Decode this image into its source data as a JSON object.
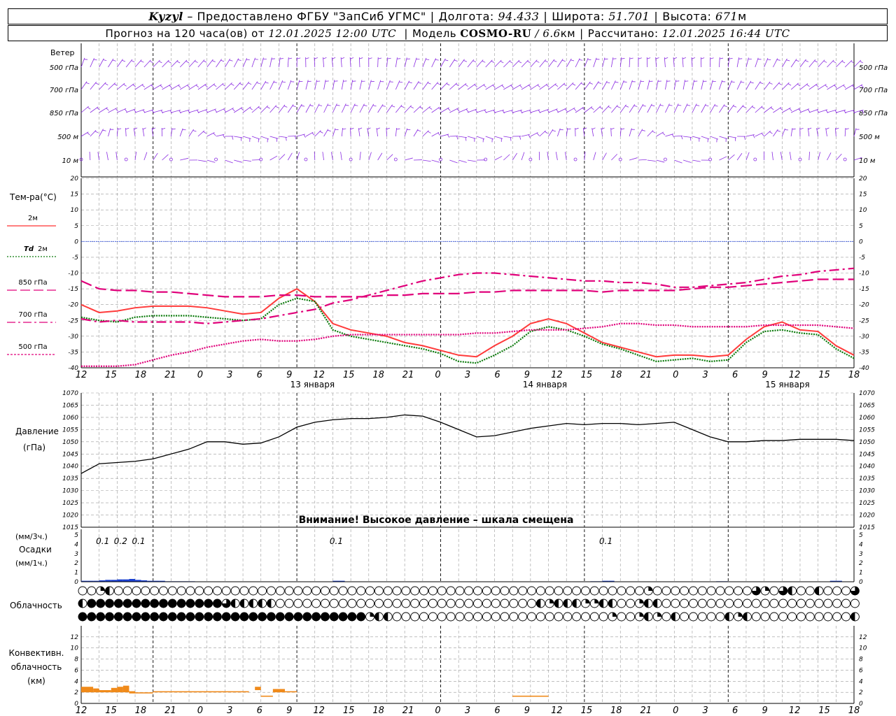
{
  "header": {
    "station": "Kyzyl",
    "provided": "– Предоставлено ФГБУ \"ЗапСиб УГМС\"",
    "lon_label": "Долгота:",
    "lon": "94.433",
    "lat_label": "Широта:",
    "lat": "51.701",
    "alt_label": "Высота:",
    "alt": "671",
    "alt_unit": "м",
    "forecast_label": "Прогноз на 120 часа(ов) от",
    "forecast_from": "12.01.2025 12:00 UTC",
    "model_label": "Модель",
    "model": "COSMO-RU",
    "model_res": "/ 6.6",
    "model_res_unit": "км",
    "calc_label": "Рассчитано:",
    "calc": "12.01.2025 16:44 UTC"
  },
  "wind_panel": {
    "title": "Ветер",
    "levels": [
      "500 гПа",
      "700 гПа",
      "850 гПа",
      "500 м",
      "10 м"
    ],
    "color": "#8a2be2"
  },
  "temp_panel": {
    "title": "Тем-ра(°С)",
    "ylim": [
      -40,
      20
    ],
    "yticks": [
      "20",
      "15",
      "10",
      "5",
      "0",
      "-5",
      "-10",
      "-15",
      "-20",
      "-25",
      "-30",
      "-35",
      "-40"
    ],
    "legend": [
      {
        "label": "2м",
        "color": "#ff3030",
        "dash": "solid"
      },
      {
        "label": "Td",
        "label2": "2м",
        "color": "#0a7a0a",
        "dash": "dot"
      },
      {
        "label": "850 гПа",
        "color": "#e0007a",
        "dash": "longdash"
      },
      {
        "label": "700 гПа",
        "color": "#e0007a",
        "dash": "dashdot"
      },
      {
        "label": "500 гПа",
        "color": "#e0007a",
        "dash": "dense"
      }
    ]
  },
  "x_axis": {
    "hour_labels": [
      "12",
      "15",
      "18",
      "21",
      "0",
      "3",
      "6",
      "9",
      "12",
      "15",
      "18",
      "21",
      "0",
      "3",
      "6",
      "9",
      "12",
      "15",
      "18",
      "21",
      "0",
      "3",
      "6",
      "9",
      "12",
      "15",
      "18"
    ],
    "day_labels": [
      "13 января",
      "14 января",
      "15 января"
    ]
  },
  "pressure_panel": {
    "title": "Давление",
    "unit": "(гПа)",
    "ylim": [
      1015,
      1070
    ],
    "yticks": [
      "1070",
      "1065",
      "1060",
      "1055",
      "1050",
      "1045",
      "1040",
      "1035",
      "1030",
      "1025",
      "1020",
      "1015"
    ],
    "notice": "Внимание! Высокое давление – шкала смещена"
  },
  "precip_panel": {
    "unit3": "(мм/3ч.)",
    "title": "Осадки",
    "unit1": "(мм/1ч.)",
    "ylim": [
      0,
      5
    ],
    "yticks": [
      "5",
      "4",
      "3",
      "2",
      "1",
      "0"
    ],
    "sum_labels": [
      {
        "text": "0.1",
        "hour": 3
      },
      {
        "text": "0.2",
        "hour": 6
      },
      {
        "text": "0.1",
        "hour": 9
      },
      {
        "text": "0.1",
        "hour": 42
      },
      {
        "text": "0.1",
        "hour": 87
      }
    ],
    "color": "#1a3fd0"
  },
  "cloud_panel": {
    "title": "Облачность",
    "rows": 3
  },
  "conv_panel": {
    "title": [
      "Конвективн.",
      "облачность",
      "(км)"
    ],
    "ylim": [
      0,
      14
    ],
    "yticks": [
      "12",
      "10",
      "8",
      "6",
      "4",
      "2",
      "0"
    ],
    "color": "#f08a1a"
  },
  "chart_data": [
    {
      "type": "line",
      "title": "Тем-ра(°С)",
      "x_unit": "hours from 12.01.2025 12:00 UTC",
      "x": [
        0,
        3,
        6,
        9,
        12,
        15,
        18,
        21,
        24,
        27,
        30,
        33,
        36,
        39,
        42,
        45,
        48,
        51,
        54,
        57,
        60,
        63,
        66,
        69,
        72,
        75,
        78,
        81,
        84,
        87,
        90,
        93,
        96,
        99,
        102,
        105,
        108,
        111,
        114,
        117,
        120,
        123,
        126,
        129
      ],
      "ylim": [
        -40,
        20
      ],
      "series": [
        {
          "name": "2м",
          "values": [
            -20,
            -22.5,
            -22,
            -21,
            -20.5,
            -20.5,
            -20.5,
            -21,
            -22,
            -23,
            -22.5,
            -18,
            -15,
            -19,
            -26,
            -28,
            -29,
            -30,
            -32,
            -33,
            -34.5,
            -36,
            -36.5,
            -33,
            -30,
            -26,
            -24.5,
            -26,
            -29,
            -32,
            -33.5,
            -35,
            -36.5,
            -36,
            -36,
            -36.5,
            -36,
            -31,
            -27,
            -25.5,
            -28,
            -28.5,
            -33,
            -36
          ]
        },
        {
          "name": "Td 2м",
          "values": [
            -24,
            -25,
            -25.5,
            -24,
            -23.5,
            -23.5,
            -23.5,
            -24,
            -24.5,
            -25,
            -24.5,
            -20,
            -18,
            -19,
            -28,
            -30,
            -31,
            -32,
            -33,
            -34,
            -35.5,
            -38,
            -38.5,
            -36,
            -33,
            -28.5,
            -27,
            -28,
            -30,
            -32.5,
            -34,
            -36,
            -38,
            -37.5,
            -37,
            -38,
            -37.5,
            -32,
            -28.5,
            -28,
            -29,
            -29.5,
            -34,
            -37
          ]
        },
        {
          "name": "850 гПа",
          "values": [
            -12.5,
            -15,
            -15.5,
            -15.5,
            -16,
            -16,
            -16.5,
            -17,
            -17.5,
            -17.5,
            -17.5,
            -17,
            -17,
            -17.5,
            -17.5,
            -17.5,
            -17.5,
            -17,
            -17,
            -16.5,
            -16.5,
            -16.5,
            -16,
            -16,
            -15.5,
            -15.5,
            -15.5,
            -15.5,
            -15.5,
            -16,
            -15.5,
            -15.5,
            -15.5,
            -15.5,
            -15,
            -14.5,
            -14.5,
            -14,
            -13.5,
            -13,
            -12.5,
            -12,
            -12,
            -12
          ]
        },
        {
          "name": "700 гПа",
          "values": [
            -24.5,
            -25.5,
            -25,
            -25.5,
            -25.5,
            -25.5,
            -25.5,
            -26,
            -25.5,
            -25,
            -24.5,
            -23.5,
            -22.5,
            -21.5,
            -19.5,
            -18.5,
            -17,
            -15.5,
            -14,
            -12.5,
            -11.5,
            -10.5,
            -10,
            -10,
            -10.5,
            -11,
            -11.5,
            -12,
            -12.5,
            -12.5,
            -13,
            -13,
            -13.5,
            -14.5,
            -14.5,
            -14,
            -13.5,
            -13,
            -12,
            -11,
            -10.5,
            -9.5,
            -9,
            -8.5
          ]
        },
        {
          "name": "500 гПа",
          "values": [
            -39.5,
            -39.5,
            -39.5,
            -39,
            -37.5,
            -36,
            -35,
            -33.5,
            -32.5,
            -31.5,
            -31,
            -31.5,
            -31.5,
            -31,
            -30,
            -29.5,
            -29.5,
            -29.5,
            -29.5,
            -29.5,
            -29.5,
            -29.5,
            -29,
            -29,
            -28.5,
            -28,
            -28,
            -28,
            -27.5,
            -27,
            -26,
            -26,
            -26.5,
            -26.5,
            -27,
            -27,
            -27,
            -27,
            -26.5,
            -26.5,
            -26.5,
            -26.5,
            -27,
            -27.5
          ]
        }
      ]
    },
    {
      "type": "line",
      "title": "Давление (гПа)",
      "x_unit": "hours from 12.01.2025 12:00 UTC",
      "x": [
        0,
        3,
        6,
        9,
        12,
        15,
        18,
        21,
        24,
        27,
        30,
        33,
        36,
        39,
        42,
        45,
        48,
        51,
        54,
        57,
        60,
        63,
        66,
        69,
        72,
        75,
        78,
        81,
        84,
        87,
        90,
        93,
        96,
        99,
        102,
        105,
        108,
        111,
        114,
        117,
        120,
        123,
        126,
        129
      ],
      "ylim": [
        1015,
        1070
      ],
      "series": [
        {
          "name": "Давление",
          "values": [
            1037,
            1041,
            1041.5,
            1042,
            1043,
            1045,
            1047,
            1050,
            1050,
            1049,
            1049.5,
            1052,
            1056,
            1058,
            1059,
            1059.5,
            1059.5,
            1060,
            1061,
            1060.5,
            1058,
            1055,
            1052,
            1052.5,
            1054,
            1055.5,
            1056.5,
            1057.5,
            1057,
            1057.5,
            1057.5,
            1057,
            1057.5,
            1058,
            1055,
            1052,
            1050,
            1050,
            1050.5,
            1050.5,
            1051,
            1051,
            1051,
            1050.5
          ]
        }
      ]
    },
    {
      "type": "bar",
      "title": "Осадки",
      "x_unit": "hours from 12.01.2025 12:00 UTC",
      "x": [
        0,
        1,
        2,
        3,
        4,
        5,
        6,
        7,
        8,
        9,
        10,
        11,
        12,
        13,
        14,
        15,
        16,
        17,
        18,
        42,
        43,
        85,
        86,
        87,
        88,
        106,
        107,
        125,
        126
      ],
      "values": [
        0.1,
        0.1,
        0.1,
        0.15,
        0.2,
        0.2,
        0.25,
        0.25,
        0.3,
        0.2,
        0.15,
        0.1,
        0.1,
        0.1,
        0.05,
        0.05,
        0.05,
        0.05,
        0.05,
        0.1,
        0.1,
        0.05,
        0.05,
        0.1,
        0.1,
        0.05,
        0.05,
        0.1,
        0.1
      ],
      "ylim": [
        0,
        5
      ]
    },
    {
      "type": "bar",
      "title": "Конвективн. облачность (км)",
      "x_unit": "hours from 12.01.2025 12:00 UTC",
      "segments": [
        {
          "x0": 0,
          "x1": 2,
          "bottom": 2,
          "top": 3
        },
        {
          "x0": 2,
          "x1": 3,
          "bottom": 2,
          "top": 2.7
        },
        {
          "x0": 3,
          "x1": 5,
          "bottom": 2,
          "top": 2.4
        },
        {
          "x0": 5,
          "x1": 6,
          "bottom": 2,
          "top": 2.8
        },
        {
          "x0": 6,
          "x1": 7,
          "bottom": 2,
          "top": 3
        },
        {
          "x0": 7,
          "x1": 8,
          "bottom": 2,
          "top": 3.2
        },
        {
          "x0": 8,
          "x1": 9,
          "bottom": 1.8,
          "top": 2.2
        },
        {
          "x0": 9,
          "x1": 12,
          "bottom": 1.8,
          "top": 2.0
        },
        {
          "x0": 12,
          "x1": 28,
          "bottom": 2,
          "top": 2.2
        },
        {
          "x0": 29,
          "x1": 30,
          "bottom": 2.4,
          "top": 3
        },
        {
          "x0": 30,
          "x1": 32,
          "bottom": 1.2,
          "top": 1.4
        },
        {
          "x0": 32,
          "x1": 34,
          "bottom": 2,
          "top": 2.6
        },
        {
          "x0": 34,
          "x1": 36,
          "bottom": 2,
          "top": 2.2
        },
        {
          "x0": 72,
          "x1": 78,
          "bottom": 1.2,
          "top": 1.4
        }
      ],
      "ylim": [
        0,
        14
      ]
    }
  ],
  "clouds": {
    "row1": [
      0,
      0,
      1,
      2,
      0,
      0,
      0,
      0,
      0,
      0,
      0,
      0,
      0,
      0,
      0,
      0,
      0,
      0,
      0,
      0,
      0,
      0,
      0,
      0,
      0,
      0,
      0,
      0,
      0,
      0,
      0,
      0,
      0,
      0,
      0,
      0,
      0,
      0,
      0,
      0,
      0,
      0,
      0,
      0,
      0,
      0,
      0,
      0,
      0,
      0,
      0,
      0,
      0,
      0,
      0,
      0,
      0,
      0,
      0,
      0,
      0,
      0,
      0,
      1,
      0,
      0,
      0,
      0,
      0,
      0,
      0,
      0,
      0,
      0,
      0,
      3,
      1,
      0,
      3,
      2,
      0,
      0,
      2,
      0,
      0,
      0,
      3,
      3,
      2,
      0,
      0,
      0,
      0,
      2,
      1,
      0,
      1,
      0,
      2,
      2,
      2,
      0,
      1,
      2,
      0,
      0,
      0,
      0,
      0,
      0,
      1,
      0,
      0,
      0,
      0,
      0,
      0,
      0,
      0,
      2,
      0,
      0,
      0,
      0,
      0,
      0,
      0,
      0,
      0,
      3,
      0,
      0
    ],
    "row2": [
      2,
      4,
      4,
      4,
      4,
      4,
      4,
      4,
      4,
      4,
      4,
      4,
      4,
      4,
      4,
      4,
      3,
      2,
      2,
      2,
      2,
      2,
      0,
      0,
      0,
      0,
      0,
      0,
      0,
      0,
      0,
      0,
      0,
      0,
      0,
      0,
      0,
      0,
      0,
      0,
      0,
      0,
      0,
      0,
      0,
      0,
      0,
      0,
      0,
      0,
      0,
      2,
      1,
      2,
      2,
      2,
      1,
      1,
      2,
      2,
      0,
      0,
      1,
      2,
      2,
      0,
      0,
      0,
      0,
      0,
      0,
      0,
      0,
      0,
      0,
      0,
      0,
      0,
      0,
      0,
      0,
      0,
      0,
      0,
      0,
      0,
      0,
      0,
      4,
      4,
      4,
      1,
      1,
      2,
      2,
      1,
      1,
      2,
      1,
      0,
      0,
      0,
      0,
      0,
      0,
      0,
      0,
      1,
      1,
      1,
      2,
      0,
      0,
      0,
      0,
      0,
      0,
      0,
      0,
      0,
      0,
      1,
      1,
      0,
      0,
      0,
      0,
      0,
      0,
      0,
      0,
      0
    ],
    "row3": [
      4,
      4,
      4,
      4,
      4,
      4,
      4,
      4,
      4,
      4,
      4,
      4,
      4,
      4,
      4,
      4,
      4,
      4,
      4,
      4,
      4,
      4,
      4,
      4,
      4,
      4,
      4,
      4,
      4,
      4,
      4,
      4,
      1,
      2,
      2,
      0,
      0,
      0,
      0,
      0,
      0,
      0,
      0,
      0,
      0,
      0,
      0,
      0,
      0,
      0,
      0,
      0,
      0,
      0,
      0,
      0,
      0,
      0,
      0,
      1,
      0,
      0,
      1,
      2,
      1,
      0,
      2,
      0,
      0,
      0,
      0,
      0,
      2,
      1,
      2,
      0,
      0,
      0,
      0,
      0,
      0,
      0,
      0,
      0,
      0,
      0,
      2,
      0,
      1,
      2,
      4,
      4,
      4,
      4,
      4,
      4,
      4,
      4,
      4,
      4,
      4,
      4,
      4,
      4,
      4,
      4,
      4,
      4,
      4,
      4,
      4,
      4,
      4,
      4,
      4,
      4,
      4,
      4,
      4,
      4,
      4,
      4,
      4,
      4,
      4,
      4,
      4,
      4,
      4,
      4,
      4,
      4,
      4
    ]
  }
}
